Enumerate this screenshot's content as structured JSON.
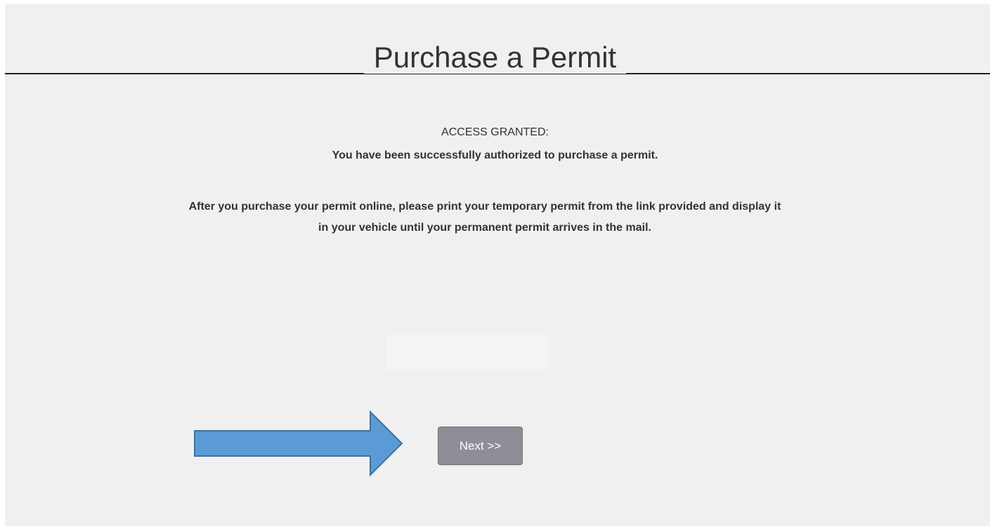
{
  "page": {
    "title": "Purchase a Permit",
    "status_label": "ACCESS GRANTED:",
    "authorized_message": "You have been successfully authorized to purchase a permit.",
    "instructions_line1": "After you purchase your permit online, please print your temporary permit from the link provided and display it",
    "instructions_line2": "in your vehicle until your permanent permit arrives in the mail."
  },
  "actions": {
    "next_label": "Next >>"
  },
  "colors": {
    "background": "#f0f0f0",
    "arrow_fill": "#5b9bd5",
    "arrow_stroke": "#41719c",
    "button": "#8e8e97"
  },
  "icons": {
    "pointer": "arrow-right-icon"
  }
}
